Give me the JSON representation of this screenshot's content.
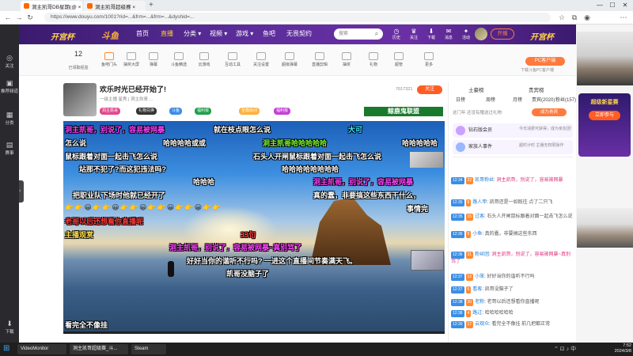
{
  "browser": {
    "tabs": [
      {
        "label": "洞主凯哥DB星期(@ ×"
      },
      {
        "label": "洞主凯哥超级赛 ×"
      }
    ],
    "url": "https://www.douyu.com/1001?rid=...&frm=...&frm=...&dyshid=...",
    "new_tab": "+"
  },
  "sidebar": {
    "items": [
      {
        "icon": "eye-icon",
        "label": "关注"
      },
      {
        "icon": "video-icon",
        "label": "推荐频道"
      },
      {
        "icon": "grid-icon",
        "label": "分类"
      },
      {
        "icon": "game-icon",
        "label": "赛事"
      },
      {
        "icon": "download-icon",
        "label": "下载"
      }
    ]
  },
  "header": {
    "event_left": "开宫杯",
    "logo": "斗鱼",
    "nav": [
      "首页",
      "直播",
      "分类 ▾",
      "视频 ▾",
      "游戏 ▾",
      "鱼吧",
      "无畏契约"
    ],
    "search_placeholder": "搜索",
    "icons": [
      {
        "name": "history-icon",
        "label": "历史"
      },
      {
        "name": "vip-icon",
        "label": "关注"
      },
      {
        "name": "download-icon",
        "label": "下载"
      },
      {
        "name": "message-icon",
        "label": "消息"
      },
      {
        "name": "notify-icon",
        "label": "活动"
      }
    ],
    "broadcast_btn": "开播",
    "event_right": "开宫杯"
  },
  "subbar": {
    "level": "12",
    "level_label": "已领取经验",
    "items": [
      "鱼吧门头",
      "抽奖大屏",
      "弹幕",
      "斗鱼精选",
      "云游戏",
      "互动工具",
      "关注设置",
      "超级弹幕",
      "直播剪辑",
      "抽奖",
      "礼物",
      "超管",
      "更多"
    ],
    "pc_btn": "PC客户端",
    "pc_sub": "下载斗鱼PC客户端"
  },
  "room": {
    "title": "欢乐时光已经开始了!",
    "meta": "一级主播 星秀 | 洞主凯哥 ...",
    "hot": "7017321",
    "follow_btn": "关注",
    "tags": [
      "洞主凯哥",
      "礼物兑换",
      "斗鱼",
      "福利报",
      "至尊房间",
      "福利报"
    ],
    "badge": "鲸鹿鬼联盟"
  },
  "danmaku": [
    {
      "text": "洞主凯哥，别说了，容易被网暴",
      "cls": "mag"
    },
    {
      "text": "就在枝点眼怎么说",
      "cls": ""
    },
    {
      "text": "哈哈哈哈或或",
      "cls": ""
    },
    {
      "text": "怎么说",
      "cls": ""
    },
    {
      "text": "洞主凯哥哈哈哈哈哈",
      "cls": "grn"
    },
    {
      "text": "哈哈哈哈哈",
      "cls": ""
    },
    {
      "text": "鼠标跟着对面一起击飞怎么说",
      "cls": ""
    },
    {
      "text": "石头人开闸鼠标跟着对面一起击飞怎么说",
      "cls": ""
    },
    {
      "text": "站那不犯了?而这犯违法吗?",
      "cls": ""
    },
    {
      "text": "哈哈哈哈哈哈哈哈",
      "cls": ""
    },
    {
      "text": "哈哈哈",
      "cls": ""
    },
    {
      "text": "洞主凯哥，别说了，容易被网暴",
      "cls": "mag"
    },
    {
      "text": "把职业队下场时他就已经开了",
      "cls": ""
    },
    {
      "text": "真的蠢，非要搞这些东西干什么，",
      "cls": ""
    },
    {
      "text": "事情完",
      "cls": ""
    },
    {
      "text": "老哥以后还想看你直播呢",
      "cls": "red"
    },
    {
      "text": "洞主凯哥，别说了，容易被网暴~真别骂了",
      "cls": "mag"
    },
    {
      "text": "好好当你的谐听不行吗? 一进这个直播间节奏满天飞。",
      "cls": ""
    },
    {
      "text": "凯哥没脑子了",
      "cls": ""
    },
    {
      "text": "看完全不像挂",
      "cls": ""
    },
    {
      "text": "33句",
      "cls": "red"
    },
    {
      "text": "大可",
      "cls": "yel"
    },
    {
      "text": "主播观赏",
      "cls": "yel"
    }
  ],
  "emoji_row": "👉👉😀👉👉😀👉👉😀👉👉😀👉👉😀👉👉",
  "video_progress": 0.0,
  "right_panel": {
    "top_tabs": [
      "土豪榜",
      "贵宾榜"
    ],
    "sub_tabs": [
      "日榜",
      "周榜",
      "月榜",
      "贵宾(2020)",
      "粉丝(157)"
    ],
    "rank_note": "这门年 还没有赠送过礼物",
    "rank_btn": "成为贵宾",
    "notices": [
      {
        "title": "钻石版会员",
        "desc": "今日消费可获得，成为亲友团特权"
      },
      {
        "title": "家族人事件",
        "desc": "超时计时 主播无权限操作"
      }
    ],
    "chat": [
      {
        "time": "12:34",
        "lv": "22",
        "name": "凯哥粉丝",
        "text": "洞主凯哥，别说了，容易被网暴",
        "hl": true
      },
      {
        "time": "12:35",
        "lv": "8",
        "name": "路人甲",
        "text": "凯哥还是一如既往 点了二只飞",
        "hl": false
      },
      {
        "time": "12:35",
        "lv": "15",
        "name": "过客",
        "text": "石头人开闸鼠标跟着对面一起击飞怎么说",
        "hl": false
      },
      {
        "time": "12:36",
        "lv": "9",
        "name": "小鱼",
        "text": "真的蠢，非要搞这些东西",
        "hl": false
      },
      {
        "time": "12:36",
        "lv": "31",
        "name": "粉丝团",
        "text": "洞主凯哥，别说了，容易被网暴~真别骂了",
        "hl": true
      },
      {
        "time": "12:37",
        "lv": "12",
        "name": "小笨",
        "text": "好好当你的谐听不行吗",
        "hl": false
      },
      {
        "time": "12:37",
        "lv": "6",
        "name": "看客",
        "text": "凯哥没脑子了",
        "hl": false
      },
      {
        "time": "12:38",
        "lv": "20",
        "name": "老粉",
        "text": "老哥以后还想看你直播呢",
        "hl": false
      },
      {
        "time": "12:38",
        "lv": "4",
        "name": "路过",
        "text": "哈哈哈哈哈哈",
        "hl": false
      },
      {
        "time": "12:39",
        "lv": "17",
        "name": "云观众",
        "text": "看完全不像挂 前几把都正常",
        "hl": false
      }
    ]
  },
  "right_side": {
    "promo_title": "超级新星赛",
    "promo_btn": "立即参与"
  },
  "taskbar": {
    "apps": [
      "VideoMonitor",
      "洞主凯哥超级赛_斗...",
      "Steam"
    ],
    "time": "7:52",
    "date": "2024/3/8"
  },
  "colors": {
    "brand": "#ff5d23",
    "header_purple": "#5b2d9a"
  }
}
